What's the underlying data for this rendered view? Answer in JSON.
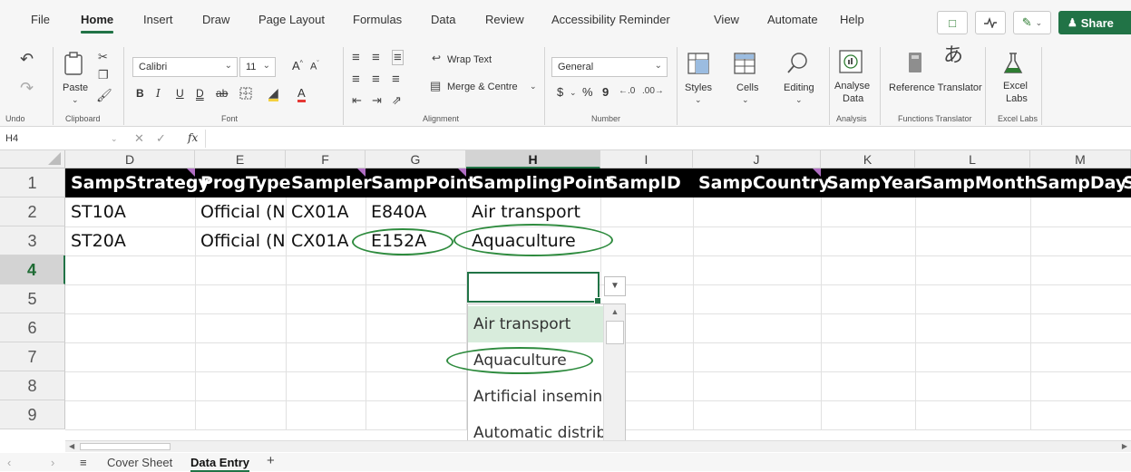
{
  "menu": {
    "tabs": [
      "File",
      "Home",
      "Insert",
      "Draw",
      "Page Layout",
      "Formulas",
      "Data",
      "Review",
      "Accessibility Reminder",
      "View",
      "Automate",
      "Help"
    ],
    "active": "Home",
    "share_label": "Share"
  },
  "ribbon": {
    "undo_label": "Undo",
    "clipboard": {
      "group": "Clipboard",
      "paste": "Paste"
    },
    "font": {
      "group": "Font",
      "name": "Calibri",
      "size": "11",
      "bold": "B",
      "italic": "I",
      "underline": "U",
      "double_underline": "D",
      "strike": "ab",
      "grow": "A",
      "shrink": "A",
      "color": "A"
    },
    "alignment": {
      "group": "Alignment",
      "wrap": "Wrap Text",
      "merge": "Merge & Centre"
    },
    "number": {
      "group": "Number",
      "format": "General",
      "currency": "$",
      "percent": "%",
      "comma": "9"
    },
    "styles": "Styles",
    "cells": "Cells",
    "editing": "Editing",
    "analyse": {
      "label_line1": "Analyse",
      "label_line2": "Data",
      "group": "Analysis"
    },
    "reference_translator": "Reference Translator",
    "functions_translator": "Functions Translator",
    "excel_labs": {
      "label_line1": "Excel",
      "label_line2": "Labs",
      "group": "Excel Labs"
    }
  },
  "formula_bar": {
    "name_box": "H4",
    "fx": "fx",
    "value": ""
  },
  "grid": {
    "columns": [
      "D",
      "E",
      "F",
      "G",
      "H",
      "I",
      "J",
      "K",
      "L",
      "M"
    ],
    "selected_column": "H",
    "rows": [
      "1",
      "2",
      "3",
      "4",
      "5",
      "6",
      "7",
      "8",
      "9"
    ],
    "selected_row": "4",
    "header_row": [
      "SampStrategy",
      "ProgType",
      "Sampler",
      "SampPoint",
      "SamplingPoint",
      "SampID",
      "SampCountry",
      "SampYear",
      "SampMonth",
      "SampDay",
      "S"
    ],
    "data_rows": [
      [
        "ST10A",
        "Official (N",
        "CX01A",
        "E840A",
        "Air transport"
      ],
      [
        "ST20A",
        "Official (N",
        "CX01A",
        "E152A",
        "Aquaculture"
      ]
    ]
  },
  "dropdown": {
    "options": [
      "Air transport",
      "Aquaculture",
      "Artificial insemina",
      "Automatic distribu"
    ],
    "highlighted": "Air transport"
  },
  "sheets": {
    "tabs": [
      "Cover Sheet",
      "Data Entry"
    ],
    "active": "Data Entry",
    "add": "+"
  }
}
